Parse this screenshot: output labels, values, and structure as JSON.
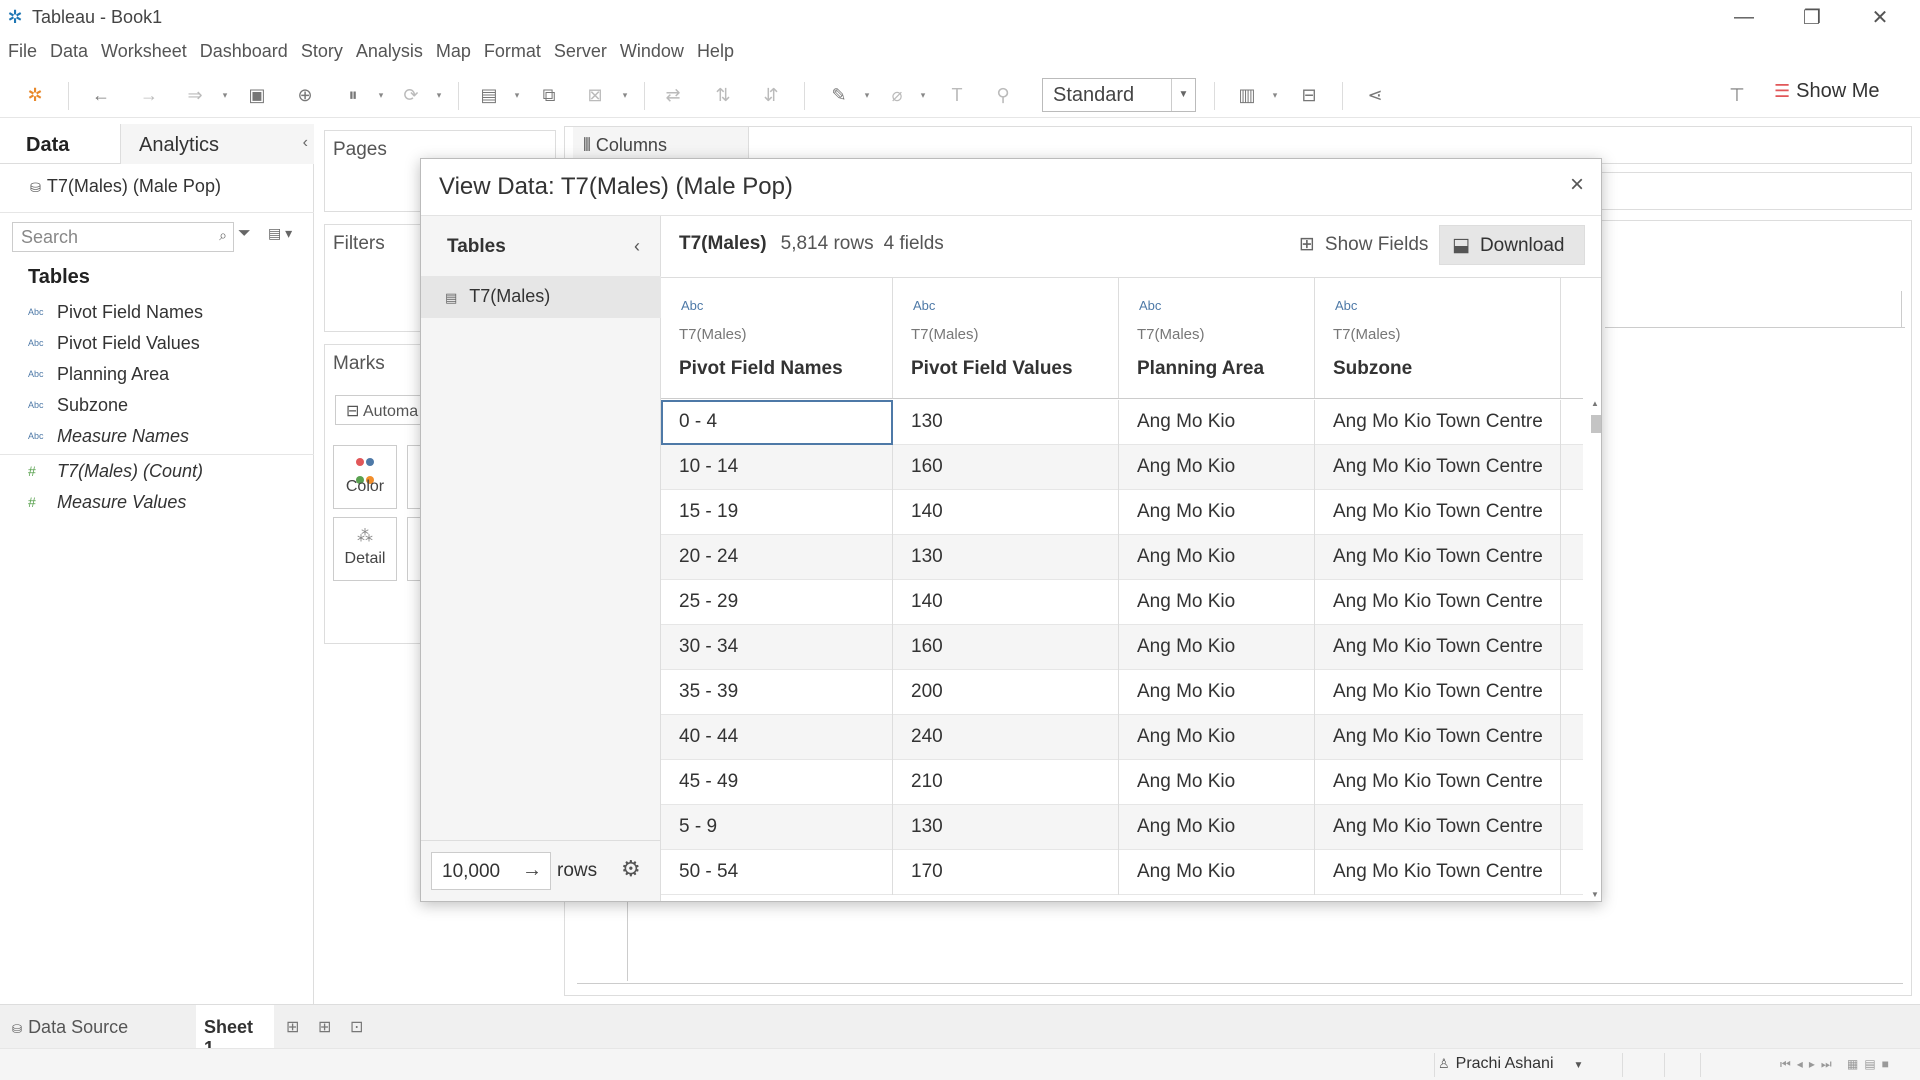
{
  "window": {
    "title": "Tableau - Book1"
  },
  "menu": [
    "File",
    "Data",
    "Worksheet",
    "Dashboard",
    "Story",
    "Analysis",
    "Map",
    "Format",
    "Server",
    "Window",
    "Help"
  ],
  "toolbar": {
    "fit": "Standard",
    "show_me": "Show Me"
  },
  "data_pane": {
    "tab_data": "Data",
    "tab_analytics": "Analytics",
    "source": "T7(Males) (Male Pop)",
    "search_placeholder": "Search",
    "tables_heading": "Tables",
    "fields": [
      {
        "name": "Pivot Field Names",
        "type": "Abc"
      },
      {
        "name": "Pivot Field Values",
        "type": "Abc"
      },
      {
        "name": "Planning Area",
        "type": "Abc"
      },
      {
        "name": "Subzone",
        "type": "Abc"
      },
      {
        "name": "Measure Names",
        "type": "Abc"
      },
      {
        "name": "T7(Males) (Count)",
        "type": "#"
      },
      {
        "name": "Measure Values",
        "type": "#"
      }
    ]
  },
  "shelves": {
    "pages": "Pages",
    "filters": "Filters",
    "marks": "Marks",
    "marks_type": "Automa",
    "color": "Color",
    "detail": "Detail",
    "columns": "Columns"
  },
  "bottom": {
    "data_source": "Data Source",
    "sheet": "Sheet 1",
    "user": "Prachi Ashani"
  },
  "dialog": {
    "title": "View Data:  T7(Males) (Male Pop)",
    "tables_heading": "Tables",
    "table_item": "T7(Males)",
    "table_name": "T7(Males)",
    "row_count": "5,814 rows",
    "field_count": "4 fields",
    "show_fields": "Show Fields",
    "download": "Download",
    "rows_limit": "10,000",
    "rows_label": "rows",
    "columns": [
      {
        "type": "Abc",
        "source": "T7(Males)",
        "name": "Pivot Field Names"
      },
      {
        "type": "Abc",
        "source": "T7(Males)",
        "name": "Pivot Field Values"
      },
      {
        "type": "Abc",
        "source": "T7(Males)",
        "name": "Planning Area"
      },
      {
        "type": "Abc",
        "source": "T7(Males)",
        "name": "Subzone"
      }
    ],
    "rows": [
      [
        "0 - 4",
        "130",
        "Ang Mo Kio",
        "Ang Mo Kio Town Centre"
      ],
      [
        "10 - 14",
        "160",
        "Ang Mo Kio",
        "Ang Mo Kio Town Centre"
      ],
      [
        "15 - 19",
        "140",
        "Ang Mo Kio",
        "Ang Mo Kio Town Centre"
      ],
      [
        "20 - 24",
        "130",
        "Ang Mo Kio",
        "Ang Mo Kio Town Centre"
      ],
      [
        "25 - 29",
        "140",
        "Ang Mo Kio",
        "Ang Mo Kio Town Centre"
      ],
      [
        "30 - 34",
        "160",
        "Ang Mo Kio",
        "Ang Mo Kio Town Centre"
      ],
      [
        "35 - 39",
        "200",
        "Ang Mo Kio",
        "Ang Mo Kio Town Centre"
      ],
      [
        "40 - 44",
        "240",
        "Ang Mo Kio",
        "Ang Mo Kio Town Centre"
      ],
      [
        "45 - 49",
        "210",
        "Ang Mo Kio",
        "Ang Mo Kio Town Centre"
      ],
      [
        "5 - 9",
        "130",
        "Ang Mo Kio",
        "Ang Mo Kio Town Centre"
      ],
      [
        "50 - 54",
        "170",
        "Ang Mo Kio",
        "Ang Mo Kio Town Centre"
      ]
    ]
  }
}
